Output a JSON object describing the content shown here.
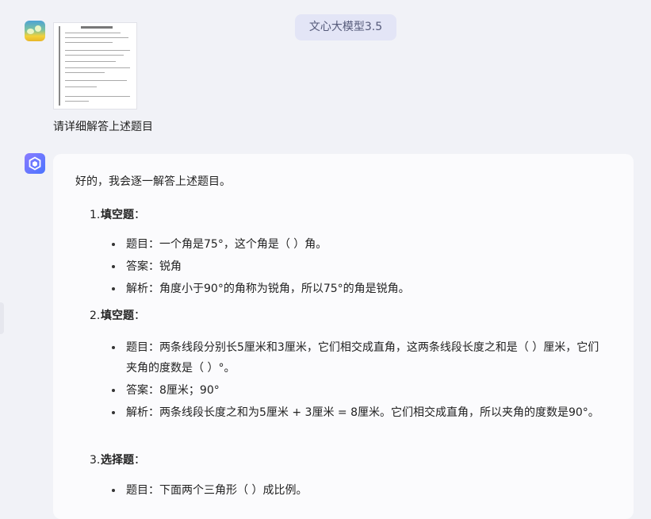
{
  "header": {
    "model_label": "文心大模型3.5"
  },
  "user_message": {
    "avatar_icon": "landscape-avatar-icon",
    "attachment_icon": "exam-paper-thumbnail",
    "text": "请详细解答上述题目"
  },
  "bot_message": {
    "avatar_icon": "cube-logo-icon",
    "intro": "好的，我会逐一解答上述题目。",
    "sections": [
      {
        "num": "1.",
        "title": "填空题",
        "colon": "：",
        "bullets": [
          "题目：一个角是75°，这个角是（ ）角。",
          "答案：锐角",
          "解析：角度小于90°的角称为锐角，所以75°的角是锐角。"
        ]
      },
      {
        "num": "2.",
        "title": "填空题",
        "colon": "：",
        "bullets": [
          "题目：两条线段分别长5厘米和3厘米，它们相交成直角，这两条线段长度之和是（ ）厘米，它们夹角的度数是（ ）°。",
          "答案：8厘米；90°",
          "解析：两条线段长度之和为5厘米 + 3厘米 = 8厘米。它们相交成直角，所以夹角的度数是90°。"
        ]
      },
      {
        "num": "3.",
        "title": "选择题",
        "colon": "：",
        "bullets": [
          "题目：下面两个三角形（ ）成比例。"
        ]
      }
    ]
  }
}
